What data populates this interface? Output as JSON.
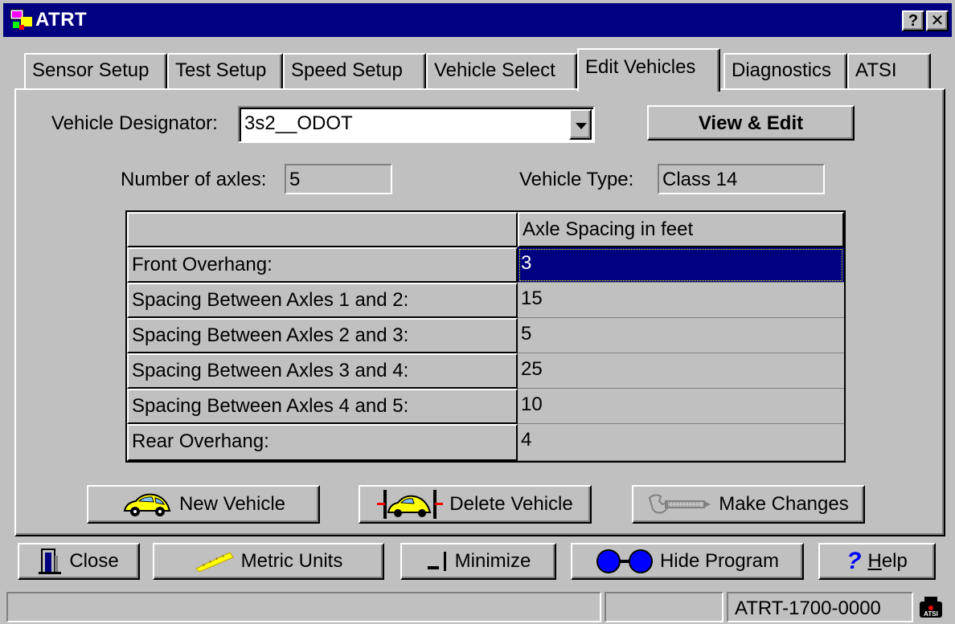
{
  "window": {
    "title": "ATRT",
    "help_button": "?",
    "close_button": "✕"
  },
  "tabs": [
    {
      "label": "Sensor Setup"
    },
    {
      "label": "Test Setup"
    },
    {
      "label": "Speed Setup"
    },
    {
      "label": "Vehicle Select"
    },
    {
      "label": "Edit Vehicles",
      "active": true
    },
    {
      "label": "Diagnostics"
    },
    {
      "label": "ATSI"
    }
  ],
  "edit": {
    "designator_label": "Vehicle Designator:",
    "designator_value": "3s2__ODOT",
    "mode_button": "View & Edit",
    "axles_label": "Number of axles:",
    "axles_value": "5",
    "type_label": "Vehicle Type:",
    "type_value": "Class 14"
  },
  "grid": {
    "column_header": "Axle Spacing in feet",
    "rows": [
      {
        "label": "Front Overhang:",
        "value": "3",
        "selected": true
      },
      {
        "label": "Spacing Between Axles  1 and  2:",
        "value": "15"
      },
      {
        "label": "Spacing Between Axles  2 and  3:",
        "value": "5"
      },
      {
        "label": "Spacing Between Axles  3 and  4:",
        "value": "25"
      },
      {
        "label": "Spacing Between Axles  4 and  5:",
        "value": "10"
      },
      {
        "label": "Rear Overhang:",
        "value": "4"
      }
    ]
  },
  "actions": {
    "new_vehicle": "New Vehicle",
    "delete_vehicle": "Delete Vehicle",
    "make_changes": "Make Changes"
  },
  "footer": {
    "close": "Close",
    "metric_units": "Metric Units",
    "minimize": "Minimize",
    "hide_program": "Hide Program",
    "help_prefix": "",
    "help_mnemonic": "H",
    "help_rest": "elp"
  },
  "status": {
    "panel1": "",
    "panel2": "",
    "device": "ATRT-1700-0000"
  },
  "colors": {
    "titlebar": "#000080",
    "face": "#c0c0c0",
    "selection": "#000080",
    "accent_blue": "#0000ff",
    "car_yellow": "#ffff00"
  }
}
